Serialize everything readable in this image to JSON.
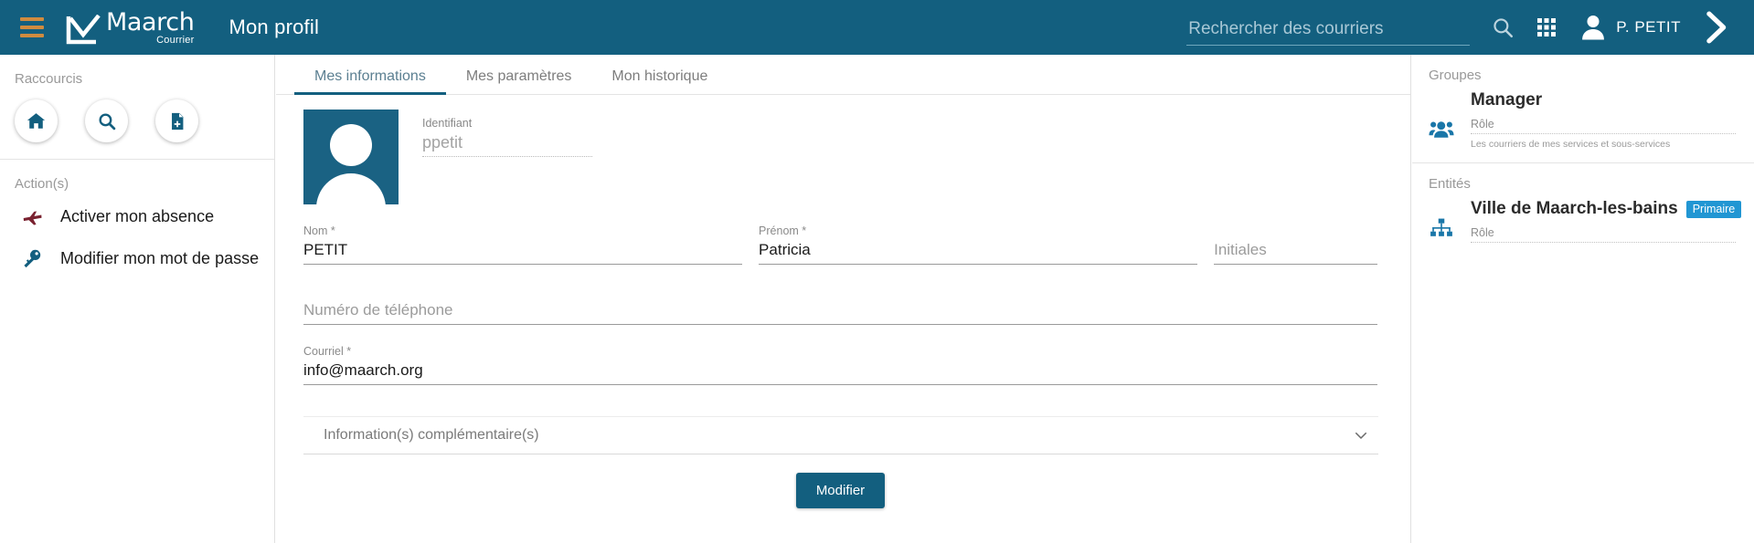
{
  "header": {
    "logo_name": "Maarch",
    "logo_sub": "Courrier",
    "app_title": "Mon profil",
    "search_placeholder": "Rechercher des courriers",
    "search_value": "",
    "user_name": "P. PETIT",
    "icons": {
      "menu": "hamburger-icon",
      "search": "search-icon",
      "apps": "grid-apps-icon",
      "user": "user-avatar-icon",
      "expand": "chevron-right-icon"
    },
    "colors": {
      "background": "#135f7f",
      "menu_accent": "#d08b3f"
    }
  },
  "sidebar": {
    "shortcuts_label": "Raccourcis",
    "shortcuts": [
      {
        "name": "home-shortcut",
        "icon": "home-icon"
      },
      {
        "name": "search-shortcut",
        "icon": "search-icon"
      },
      {
        "name": "new-document-shortcut",
        "icon": "document-add-icon"
      }
    ],
    "actions_label": "Action(s)",
    "actions": [
      {
        "label": "Activer mon absence",
        "icon": "airplane-icon",
        "color": "#7a2230"
      },
      {
        "label": "Modifier mon mot de passe",
        "icon": "key-icon",
        "color": "#135f7f"
      }
    ]
  },
  "main": {
    "tabs": [
      {
        "label": "Mes informations",
        "active": true
      },
      {
        "label": "Mes paramètres",
        "active": false
      },
      {
        "label": "Mon historique",
        "active": false
      }
    ],
    "avatar_alt": "profile-picture",
    "identifiant": {
      "label": "Identifiant",
      "value": "ppetit"
    },
    "fields": {
      "nom": {
        "label": "Nom *",
        "value": "PETIT"
      },
      "prenom": {
        "label": "Prénom *",
        "value": "Patricia"
      },
      "initiales": {
        "label": "Initiales",
        "value": ""
      },
      "telephone": {
        "label": "Numéro de téléphone",
        "value": ""
      },
      "courriel": {
        "label": "Courriel *",
        "value": "info@maarch.org"
      }
    },
    "expander_label": "Information(s) complémentaire(s)",
    "submit_label": "Modifier"
  },
  "right_panel": {
    "groupes_label": "Groupes",
    "groupes": [
      {
        "name": "Manager",
        "role_label": "Rôle",
        "role_value": "",
        "note": "Les courriers de mes services et sous-services",
        "icon": "group-users-icon"
      }
    ],
    "entites_label": "Entités",
    "entites": [
      {
        "name": "Ville de Maarch-les-bains",
        "badge": "Primaire",
        "role_label": "Rôle",
        "role_value": "",
        "icon": "org-chart-icon"
      }
    ]
  }
}
